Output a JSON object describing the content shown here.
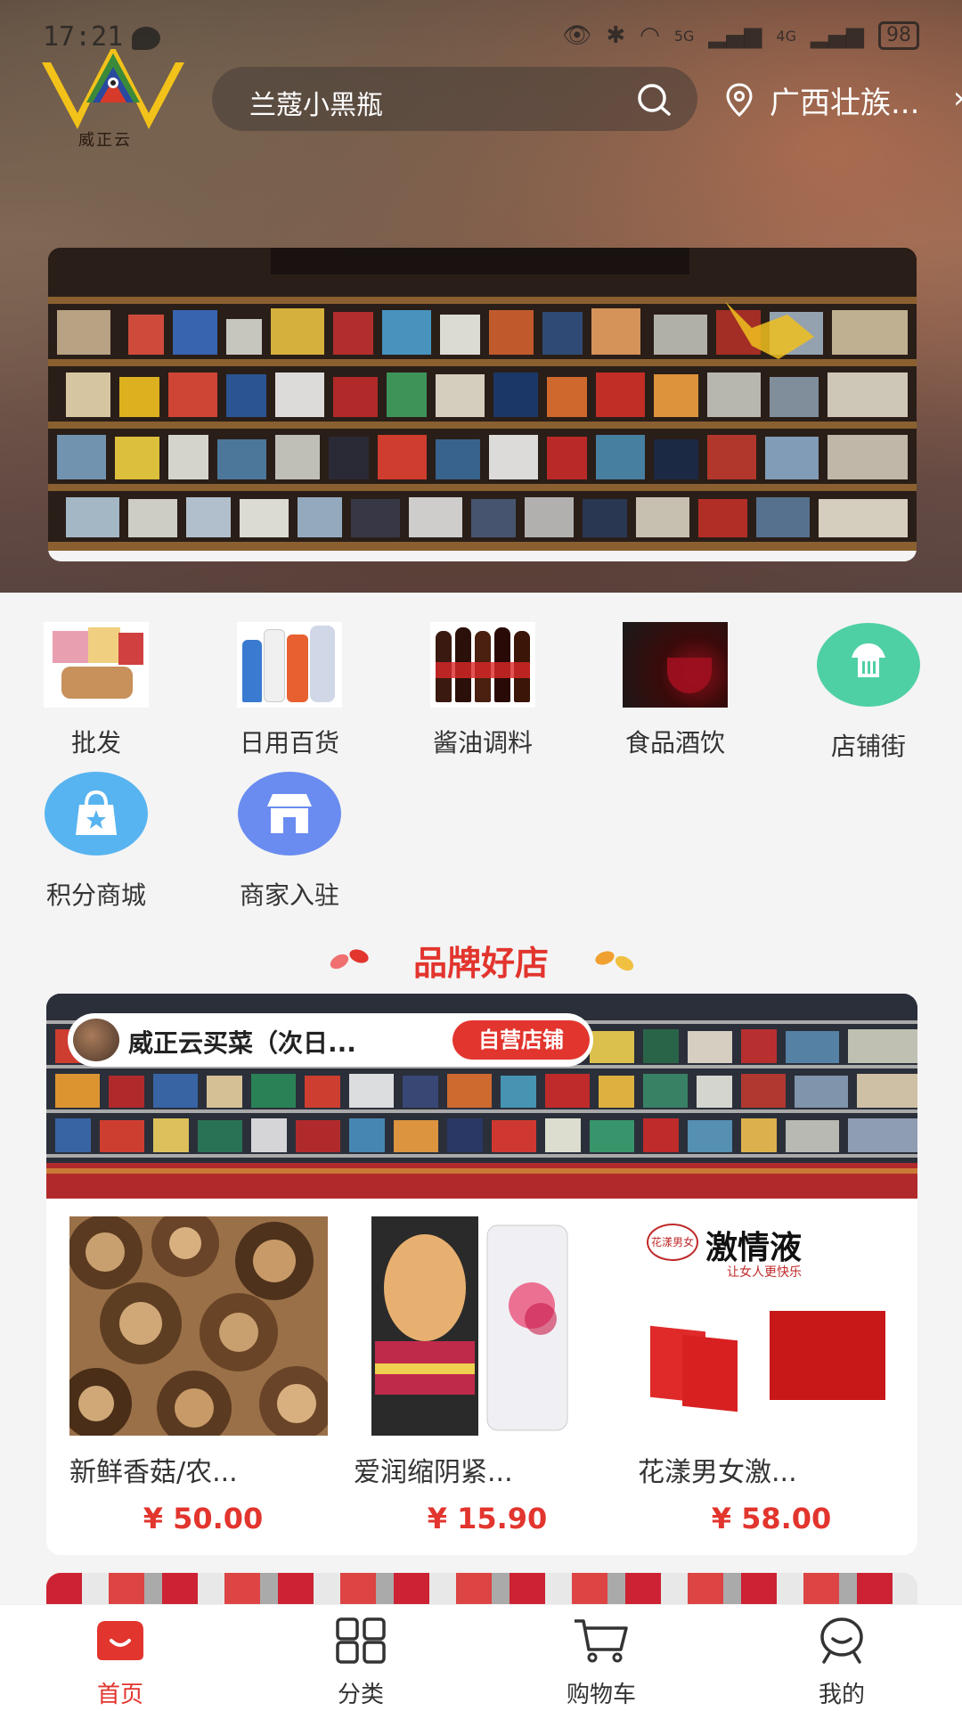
{
  "status_bar": {
    "time": "17:21",
    "network_1": "5G",
    "network_2": "4G",
    "battery": "98"
  },
  "header": {
    "logo_text": "威正云",
    "search_placeholder": "兰蔻小黑瓶",
    "location": "广西壮族..."
  },
  "categories": [
    {
      "label": "批发"
    },
    {
      "label": "日用百货"
    },
    {
      "label": "酱油调料"
    },
    {
      "label": "食品酒饮"
    },
    {
      "label": "店铺街"
    },
    {
      "label": "积分商城"
    },
    {
      "label": "商家入驻"
    }
  ],
  "section_title": "品牌好店",
  "store": {
    "name": "威正云买菜（次日...",
    "tag": "自营店铺",
    "products": [
      {
        "name": "新鲜香菇/农...",
        "price": "¥ 50.00"
      },
      {
        "name": "爱润缩阴紧...",
        "price": "¥ 15.90"
      },
      {
        "name": "花漾男女激...",
        "price": "¥ 58.00",
        "img_text": "激情液",
        "img_brand": "花漾男女",
        "img_sub": "让女人更快乐"
      }
    ]
  },
  "nav": [
    {
      "label": "首页",
      "active": true
    },
    {
      "label": "分类"
    },
    {
      "label": "购物车"
    },
    {
      "label": "我的"
    }
  ],
  "colors": {
    "accent": "#e2352e"
  }
}
